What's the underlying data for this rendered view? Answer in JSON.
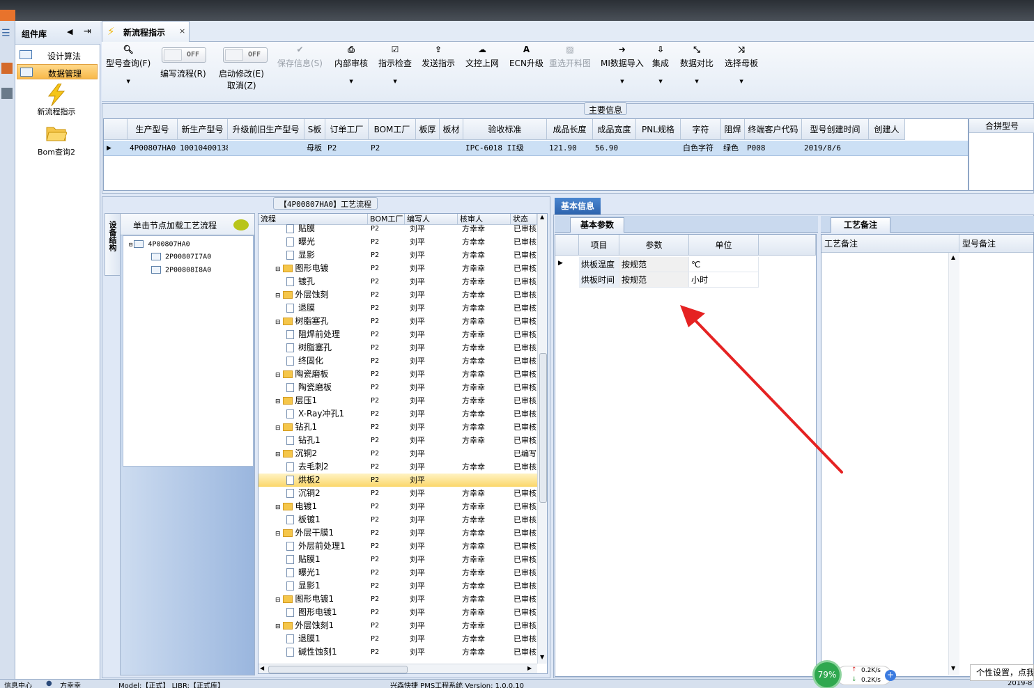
{
  "component_library": {
    "title": "组件库",
    "items": [
      {
        "label": "设计算法",
        "selected": false
      },
      {
        "label": "数据管理",
        "selected": true
      }
    ],
    "tools": [
      {
        "label": "新流程指示",
        "icon": "lightning-icon"
      },
      {
        "label": "Bom查询2",
        "icon": "folder-open-icon"
      }
    ]
  },
  "doc_tab": {
    "label": "新流程指示",
    "close": "×"
  },
  "ribbon": {
    "query_model": "型号查询(F)",
    "edit_flow": "编写流程(R)",
    "edit_flow_toggle": "OFF",
    "enable_modify": "启动修改(E)",
    "enable_modify_toggle": "OFF",
    "cancel": "取消(Z)",
    "save_info": "保存信息(S)",
    "internal_review": "内部审核",
    "instruction_check": "指示检查",
    "send_instruction": "发送指示",
    "doc_upload": "文控上网",
    "ecn_upgrade": "ECN升级",
    "reselect_drawing": "重选开料图",
    "mi_import": "MI数据导入",
    "integrate": "集成",
    "data_compare": "数据对比",
    "select_master": "选择母板"
  },
  "main_info": {
    "title": "主要信息",
    "columns": [
      "生产型号",
      "新生产型号",
      "升级前旧生产型号",
      "S板",
      "订单工厂",
      "BOM工厂",
      "板厚",
      "板材",
      "验收标准",
      "成品长度",
      "成品宽度",
      "PNL规格",
      "字符",
      "阻焊",
      "终端客户代码",
      "型号创建时间",
      "创建人"
    ],
    "row": [
      "4P00807HA0",
      "10010400138212",
      "",
      "母板",
      "P2",
      "P2",
      "",
      "",
      "IPC-6018 II级",
      "121.90",
      "56.90",
      "",
      "白色字符",
      "绿色",
      "P008",
      "2019/8/6",
      ""
    ],
    "merge_header": "合拼型号"
  },
  "process": {
    "title": "【4P00807HA0】工艺流程",
    "side_tab": "设备结构",
    "tree_header": "单击节点加载工艺流程",
    "tree_nodes": [
      "4P00807HA0",
      "2P00807I7A0",
      "2P00808I8A0"
    ],
    "columns": [
      "流程",
      "BOM工厂",
      "编写人",
      "核审人",
      "状态"
    ],
    "rows": [
      {
        "name": "贴膜",
        "type": "step",
        "bom": "P2",
        "writer": "刘平",
        "reviewer": "方幸幸",
        "status": "已审核"
      },
      {
        "name": "曝光",
        "type": "step",
        "bom": "P2",
        "writer": "刘平",
        "reviewer": "方幸幸",
        "status": "已审核"
      },
      {
        "name": "显影",
        "type": "step",
        "bom": "P2",
        "writer": "刘平",
        "reviewer": "方幸幸",
        "status": "已审核"
      },
      {
        "name": "图形电镀",
        "type": "folder",
        "bom": "P2",
        "writer": "刘平",
        "reviewer": "方幸幸",
        "status": "已审核"
      },
      {
        "name": "镀孔",
        "type": "step",
        "bom": "P2",
        "writer": "刘平",
        "reviewer": "方幸幸",
        "status": "已审核"
      },
      {
        "name": "外层蚀刻",
        "type": "folder",
        "bom": "P2",
        "writer": "刘平",
        "reviewer": "方幸幸",
        "status": "已审核"
      },
      {
        "name": "退膜",
        "type": "step",
        "bom": "P2",
        "writer": "刘平",
        "reviewer": "方幸幸",
        "status": "已审核"
      },
      {
        "name": "树脂塞孔",
        "type": "folder",
        "bom": "P2",
        "writer": "刘平",
        "reviewer": "方幸幸",
        "status": "已审核"
      },
      {
        "name": "阻焊前处理",
        "type": "step",
        "bom": "P2",
        "writer": "刘平",
        "reviewer": "方幸幸",
        "status": "已审核"
      },
      {
        "name": "树脂塞孔",
        "type": "step",
        "bom": "P2",
        "writer": "刘平",
        "reviewer": "方幸幸",
        "status": "已审核"
      },
      {
        "name": "终固化",
        "type": "step",
        "bom": "P2",
        "writer": "刘平",
        "reviewer": "方幸幸",
        "status": "已审核"
      },
      {
        "name": "陶瓷磨板",
        "type": "folder",
        "bom": "P2",
        "writer": "刘平",
        "reviewer": "方幸幸",
        "status": "已审核"
      },
      {
        "name": "陶瓷磨板",
        "type": "step",
        "bom": "P2",
        "writer": "刘平",
        "reviewer": "方幸幸",
        "status": "已审核"
      },
      {
        "name": "层压1",
        "type": "folder",
        "bom": "P2",
        "writer": "刘平",
        "reviewer": "方幸幸",
        "status": "已审核"
      },
      {
        "name": "X-Ray冲孔1",
        "type": "step",
        "bom": "P2",
        "writer": "刘平",
        "reviewer": "方幸幸",
        "status": "已审核"
      },
      {
        "name": "钻孔1",
        "type": "folder",
        "bom": "P2",
        "writer": "刘平",
        "reviewer": "方幸幸",
        "status": "已审核"
      },
      {
        "name": "钻孔1",
        "type": "step",
        "bom": "P2",
        "writer": "刘平",
        "reviewer": "方幸幸",
        "status": "已审核"
      },
      {
        "name": "沉铜2",
        "type": "folder",
        "bom": "P2",
        "writer": "刘平",
        "reviewer": "",
        "status": "已编写"
      },
      {
        "name": "去毛刺2",
        "type": "step",
        "bom": "P2",
        "writer": "刘平",
        "reviewer": "方幸幸",
        "status": "已审核"
      },
      {
        "name": "烘板2",
        "type": "step",
        "bom": "P2",
        "writer": "刘平",
        "reviewer": "",
        "status": "",
        "highlight": true
      },
      {
        "name": "沉铜2",
        "type": "step",
        "bom": "P2",
        "writer": "刘平",
        "reviewer": "方幸幸",
        "status": "已审核"
      },
      {
        "name": "电镀1",
        "type": "folder",
        "bom": "P2",
        "writer": "刘平",
        "reviewer": "方幸幸",
        "status": "已审核"
      },
      {
        "name": "板镀1",
        "type": "step",
        "bom": "P2",
        "writer": "刘平",
        "reviewer": "方幸幸",
        "status": "已审核"
      },
      {
        "name": "外层干膜1",
        "type": "folder",
        "bom": "P2",
        "writer": "刘平",
        "reviewer": "方幸幸",
        "status": "已审核"
      },
      {
        "name": "外层前处理1",
        "type": "step",
        "bom": "P2",
        "writer": "刘平",
        "reviewer": "方幸幸",
        "status": "已审核"
      },
      {
        "name": "贴膜1",
        "type": "step",
        "bom": "P2",
        "writer": "刘平",
        "reviewer": "方幸幸",
        "status": "已审核"
      },
      {
        "name": "曝光1",
        "type": "step",
        "bom": "P2",
        "writer": "刘平",
        "reviewer": "方幸幸",
        "status": "已审核"
      },
      {
        "name": "显影1",
        "type": "step",
        "bom": "P2",
        "writer": "刘平",
        "reviewer": "方幸幸",
        "status": "已审核"
      },
      {
        "name": "图形电镀1",
        "type": "folder",
        "bom": "P2",
        "writer": "刘平",
        "reviewer": "方幸幸",
        "status": "已审核"
      },
      {
        "name": "图形电镀1",
        "type": "step",
        "bom": "P2",
        "writer": "刘平",
        "reviewer": "方幸幸",
        "status": "已审核"
      },
      {
        "name": "外层蚀刻1",
        "type": "folder",
        "bom": "P2",
        "writer": "刘平",
        "reviewer": "方幸幸",
        "status": "已审核"
      },
      {
        "name": "退膜1",
        "type": "step",
        "bom": "P2",
        "writer": "刘平",
        "reviewer": "方幸幸",
        "status": "已审核"
      },
      {
        "name": "碱性蚀刻1",
        "type": "step",
        "bom": "P2",
        "writer": "刘平",
        "reviewer": "方幸幸",
        "status": "已审核"
      }
    ]
  },
  "basic_info": {
    "tab": "基本信息",
    "param_tab": "基本参数",
    "columns": [
      "项目",
      "参数",
      "单位"
    ],
    "rows": [
      {
        "item": "烘板温度",
        "param": "按规范",
        "unit": "℃"
      },
      {
        "item": "烘板时间",
        "param": "按规范",
        "unit": "小时"
      }
    ],
    "note_tab": "工艺备注",
    "note_columns": [
      "工艺备注",
      "型号备注"
    ]
  },
  "statusbar": {
    "left": "信息中心",
    "user": "方幸幸",
    "mid": "Model:【正式】 LIBR:【正式库】",
    "app": "兴森快捷 PMS工程系统 Version: 1.0.0.10",
    "date": "2019-8"
  },
  "netwidget": {
    "percent": "79%",
    "up": "0.2K/s",
    "down": "0.2K/s"
  },
  "personal_settings": "个性设置，点我"
}
